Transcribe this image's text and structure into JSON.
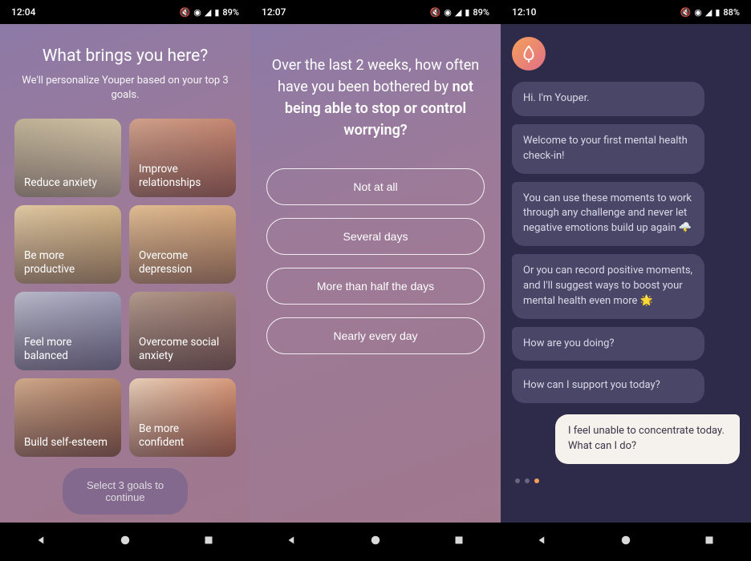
{
  "screen1": {
    "status": {
      "time": "12:04",
      "battery": "89%"
    },
    "title": "What brings you here?",
    "subtitle": "We'll personalize Youper based on your top 3 goals.",
    "goals": [
      "Reduce anxiety",
      "Improve relationships",
      "Be more productive",
      "Overcome depression",
      "Feel more balanced",
      "Overcome social anxiety",
      "Build self-esteem",
      "Be more confident"
    ],
    "cta": "Select 3 goals to continue"
  },
  "screen2": {
    "status": {
      "time": "12:07",
      "battery": "89%"
    },
    "question_lead": "Over the last 2 weeks, how often have you been bothered by ",
    "question_bold": "not being able to stop or control worrying?",
    "options": [
      "Not at all",
      "Several days",
      "More than half the days",
      "Nearly every day"
    ]
  },
  "screen3": {
    "status": {
      "time": "12:10",
      "battery": "88%"
    },
    "bot_messages": [
      "Hi. I'm Youper.",
      "Welcome to your first mental health check-in!",
      "You can use these moments to work through any challenge and never let negative emotions build up again 🌩️",
      "Or you can record positive moments, and I'll suggest ways to boost your mental health even more 🌟",
      "How are you doing?",
      "How can I support you today?"
    ],
    "user_message": "I feel unable to concentrate today. What can I do?"
  }
}
